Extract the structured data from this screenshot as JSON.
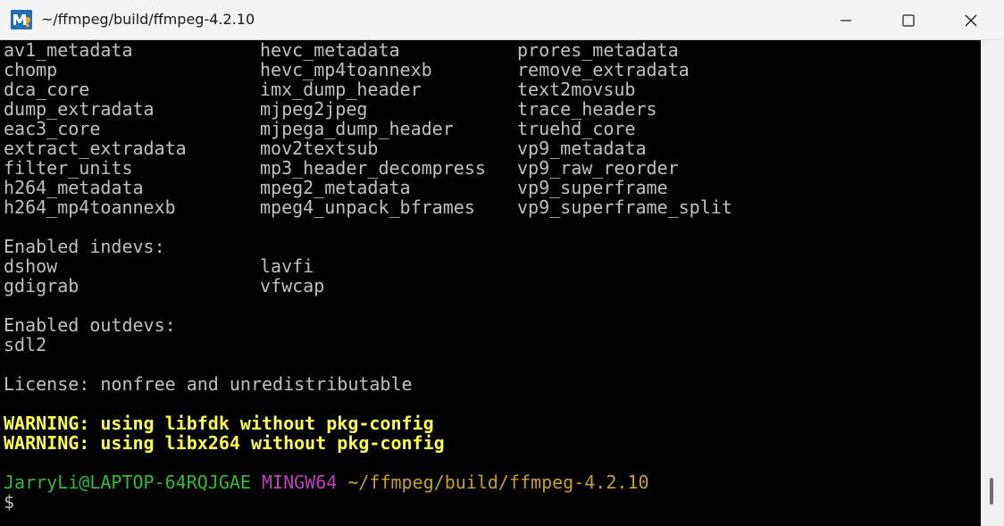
{
  "window": {
    "title": "~/ffmpeg/build/ffmpeg-4.2.10",
    "app_icon": "msys2-mintty-icon",
    "controls": [
      "minimize-icon",
      "maximize-icon",
      "close-icon"
    ]
  },
  "terminal": {
    "bsf_columns": [
      [
        "av1_metadata",
        "hevc_metadata",
        "prores_metadata"
      ],
      [
        "chomp",
        "hevc_mp4toannexb",
        "remove_extradata"
      ],
      [
        "dca_core",
        "imx_dump_header",
        "text2movsub"
      ],
      [
        "dump_extradata",
        "mjpeg2jpeg",
        "trace_headers"
      ],
      [
        "eac3_core",
        "mjpega_dump_header",
        "truehd_core"
      ],
      [
        "extract_extradata",
        "mov2textsub",
        "vp9_metadata"
      ],
      [
        "filter_units",
        "mp3_header_decompress",
        "vp9_raw_reorder"
      ],
      [
        "h264_metadata",
        "mpeg2_metadata",
        "vp9_superframe"
      ],
      [
        "h264_mp4toannexb",
        "mpeg4_unpack_bframes",
        "vp9_superframe_split"
      ]
    ],
    "indevs_header": "Enabled indevs:",
    "indevs": [
      [
        "dshow",
        "lavfi"
      ],
      [
        "gdigrab",
        "vfwcap"
      ]
    ],
    "outdevs_header": "Enabled outdevs:",
    "outdevs": [
      "sdl2"
    ],
    "license": "License: nonfree and unredistributable",
    "warnings": [
      "WARNING: using libfdk without pkg-config",
      "WARNING: using libx264 without pkg-config"
    ],
    "prompt": {
      "user_host": "JarryLi@LAPTOP-64RQJGAE",
      "system": "MINGW64",
      "path": "~/ffmpeg/build/ffmpeg-4.2.10",
      "symbol": "$"
    }
  },
  "colors": {
    "background": "#000000",
    "text": "#c0c0c0",
    "warning": "#ffff3f",
    "prompt_user": "#2bbf30",
    "prompt_system": "#bf3fbf",
    "prompt_path": "#c8a020"
  }
}
